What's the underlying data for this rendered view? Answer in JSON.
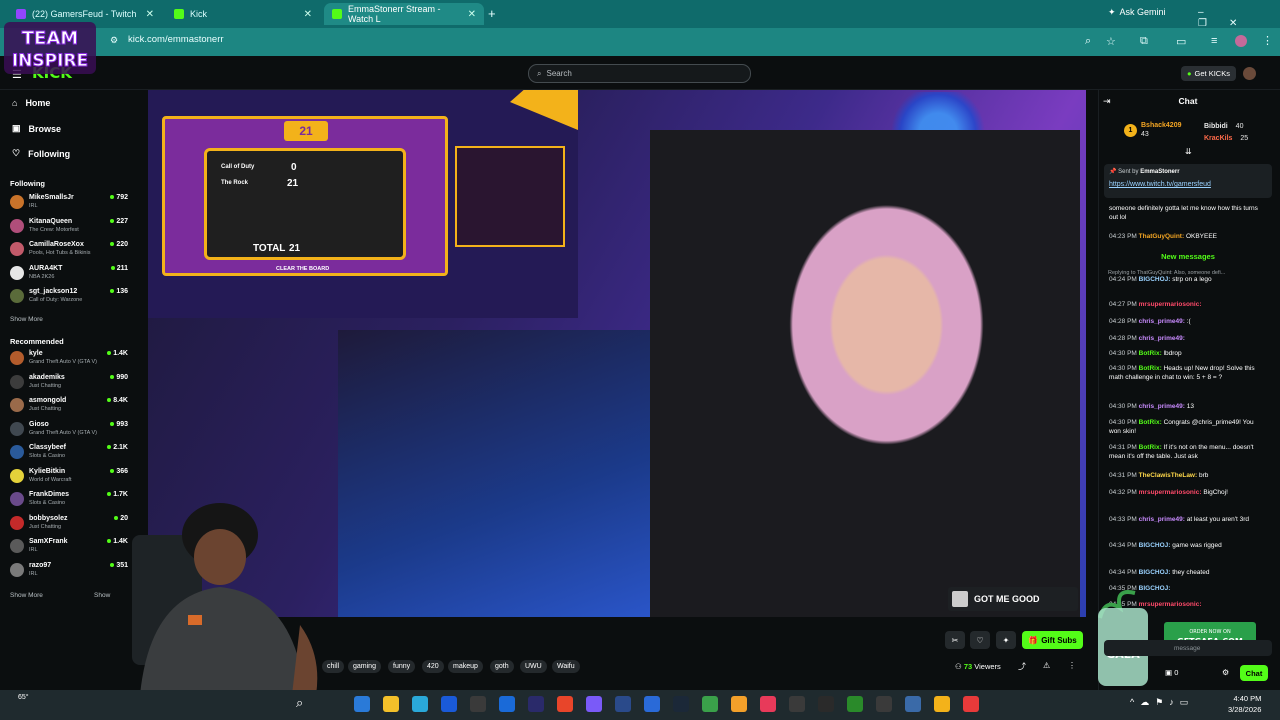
{
  "browser": {
    "tabs": [
      {
        "label": "(22) GamersFeud - Twitch",
        "color": "#9146ff"
      },
      {
        "label": "Kick",
        "color": "#53fc18"
      },
      {
        "label": "EmmaStonerr Stream - Watch L",
        "color": "#53fc18"
      }
    ],
    "new_tab": "+",
    "ask_gemini": "Ask Gemini",
    "url": "kick.com/emmastonerr"
  },
  "header": {
    "logo": "KICK",
    "search_placeholder": "Search",
    "get_kicks": "Get KICKs"
  },
  "team_logo": {
    "line1": "TEAM",
    "line2": "INSPIRE"
  },
  "sidebar": {
    "nav": [
      {
        "label": "Home",
        "icon": "home-icon"
      },
      {
        "label": "Browse",
        "icon": "browse-icon"
      },
      {
        "label": "Following",
        "icon": "heart-icon"
      }
    ],
    "following_title": "Following",
    "following": [
      {
        "name": "MikeSmallsJr",
        "game": "IRL",
        "viewers": "792",
        "color": "#c9732a"
      },
      {
        "name": "KitanaQueen",
        "game": "The Crew: Motorfest",
        "viewers": "227",
        "color": "#b04e7a"
      },
      {
        "name": "CamillaRoseXox",
        "game": "Pools, Hot Tubs & Bikinis",
        "viewers": "220",
        "color": "#c25a6a"
      },
      {
        "name": "AURA4KT",
        "game": "NBA 2K26",
        "viewers": "211",
        "color": "#e6e6e6"
      },
      {
        "name": "sgt_jackson12",
        "game": "Call of Duty: Warzone",
        "viewers": "136",
        "color": "#5a6b3a"
      }
    ],
    "show_more_1": "Show More",
    "recommended_title": "Recommended",
    "recommended": [
      {
        "name": "kyle",
        "game": "Grand Theft Auto V (GTA V)",
        "viewers": "1.4K",
        "color": "#b35c2c"
      },
      {
        "name": "akademiks",
        "game": "Just Chatting",
        "viewers": "990",
        "color": "#3c3c3c"
      },
      {
        "name": "asmongold",
        "game": "Just Chatting",
        "viewers": "8.4K",
        "color": "#9a6a4a"
      },
      {
        "name": "Gioso",
        "game": "Grand Theft Auto V (GTA V)",
        "viewers": "993",
        "color": "#404850"
      },
      {
        "name": "Classybeef",
        "game": "Slots & Casino",
        "viewers": "2.1K",
        "color": "#2a5a9a"
      },
      {
        "name": "KylieBitkin",
        "game": "World of Warcraft",
        "viewers": "366",
        "color": "#e4d23a"
      },
      {
        "name": "FrankDimes",
        "game": "Slots & Casino",
        "viewers": "1.7K",
        "color": "#6a4a8a"
      },
      {
        "name": "bobbysolez",
        "game": "Just Chatting",
        "viewers": "20",
        "color": "#c42a2a"
      },
      {
        "name": "SamXFrank",
        "game": "IRL",
        "viewers": "1.4K",
        "color": "#5a5a5a"
      },
      {
        "name": "razo97",
        "game": "IRL",
        "viewers": "351",
        "color": "#7a7a7a"
      }
    ],
    "show_more_2": "Show More",
    "show_less": "Show"
  },
  "overlay": {
    "board_score": "21",
    "rows": [
      {
        "label": "Call of Duty",
        "value": "0"
      },
      {
        "label": "The Rock",
        "value": "21"
      }
    ],
    "total_label": "TOTAL",
    "total_value": "21",
    "clear_board": "CLEAR THE BOARD"
  },
  "alert": {
    "text": "GOT ME GOOD"
  },
  "below_video": {
    "tags": [
      "chill",
      "gaming",
      "funny",
      "420",
      "makeup",
      "goth",
      "UWU",
      "Waifu"
    ],
    "gift_subs": "Gift Subs",
    "viewers_count": "73",
    "viewers_label": "Viewers"
  },
  "chat": {
    "title": "Chat",
    "leaderboard": [
      {
        "rank": "1",
        "name": "Bshack4209",
        "value": "43"
      },
      {
        "name": "Bibbidi",
        "value": "40"
      },
      {
        "name": "KracKils",
        "value": "25"
      }
    ],
    "pinned_by": "Sent by",
    "pinned_user": "EmmaStonerr",
    "pinned_link": "https://www.twitch.tv/gamersfeud",
    "new_messages": "New messages",
    "reply_note": "Replying to ThatGuyQuint: Also, someone defi...",
    "messages": [
      {
        "time": "",
        "user": "",
        "text": "someone definitely gotta let me know how this turns out lol",
        "color": "#fff"
      },
      {
        "time": "04:23 PM",
        "user": "ThatGuyQuint:",
        "text": "OKBYEEE",
        "color": "#f5a623"
      },
      {
        "time": "04:24 PM",
        "user": "BIGCHOJ:",
        "text": "strp on a lego",
        "color": "#9ad2ff"
      },
      {
        "time": "04:27 PM",
        "user": "mrsupermariosonic:",
        "text": "",
        "color": "#ff4a6a"
      },
      {
        "time": "04:28 PM",
        "user": "chris_prime49:",
        "text": ":(",
        "color": "#c98bff"
      },
      {
        "time": "04:28 PM",
        "user": "chris_prime49:",
        "text": "",
        "color": "#c98bff"
      },
      {
        "time": "04:30 PM",
        "user": "BotRix:",
        "text": "lbdrop",
        "color": "#53fc18"
      },
      {
        "time": "04:30 PM",
        "user": "BotRix:",
        "text": "Heads up! New drop! Solve this math challenge in chat to win: 5 + 8 = ?",
        "color": "#53fc18"
      },
      {
        "time": "04:30 PM",
        "user": "chris_prime49:",
        "text": "13",
        "color": "#c98bff"
      },
      {
        "time": "04:30 PM",
        "user": "BotRix:",
        "text": "Congrats @chris_prime49! You won skin!",
        "color": "#53fc18"
      },
      {
        "time": "04:31 PM",
        "user": "BotRix:",
        "text": "If it's not on the menu... doesn't mean it's off the table. Just ask",
        "color": "#53fc18"
      },
      {
        "time": "04:31 PM",
        "user": "TheClawisTheLaw:",
        "text": "brb",
        "color": "#ffd84a"
      },
      {
        "time": "04:32 PM",
        "user": "mrsupermariosonic:",
        "text": "BigChoj!",
        "color": "#ff4a6a"
      },
      {
        "time": "04:33 PM",
        "user": "chris_prime49:",
        "text": "at least you aren't 3rd",
        "color": "#c98bff"
      },
      {
        "time": "04:34 PM",
        "user": "BIGCHOJ:",
        "text": "game was rigged",
        "color": "#9ad2ff"
      },
      {
        "time": "04:34 PM",
        "user": "BIGCHOJ:",
        "text": "they cheated",
        "color": "#9ad2ff"
      },
      {
        "time": "04:35 PM",
        "user": "BIGCHOJ:",
        "text": "",
        "color": "#9ad2ff"
      },
      {
        "time": "04:35 PM",
        "user": "mrsupermariosonic:",
        "text": "",
        "color": "#ff4a6a"
      }
    ],
    "input_placeholder": "message",
    "kicks_count": "0",
    "chat_button": "Chat"
  },
  "ad": {
    "line1": "ORDER NOW ON",
    "line2": "GETGAEA.COM",
    "brand": "GAEA"
  },
  "taskbar": {
    "temp": "65°",
    "time": "4:40 PM",
    "date": "3/28/2026"
  },
  "colors": {
    "kick_green": "#53fc18",
    "chrome_teal": "#1d8682",
    "tab_teal": "#0f6b6b"
  }
}
